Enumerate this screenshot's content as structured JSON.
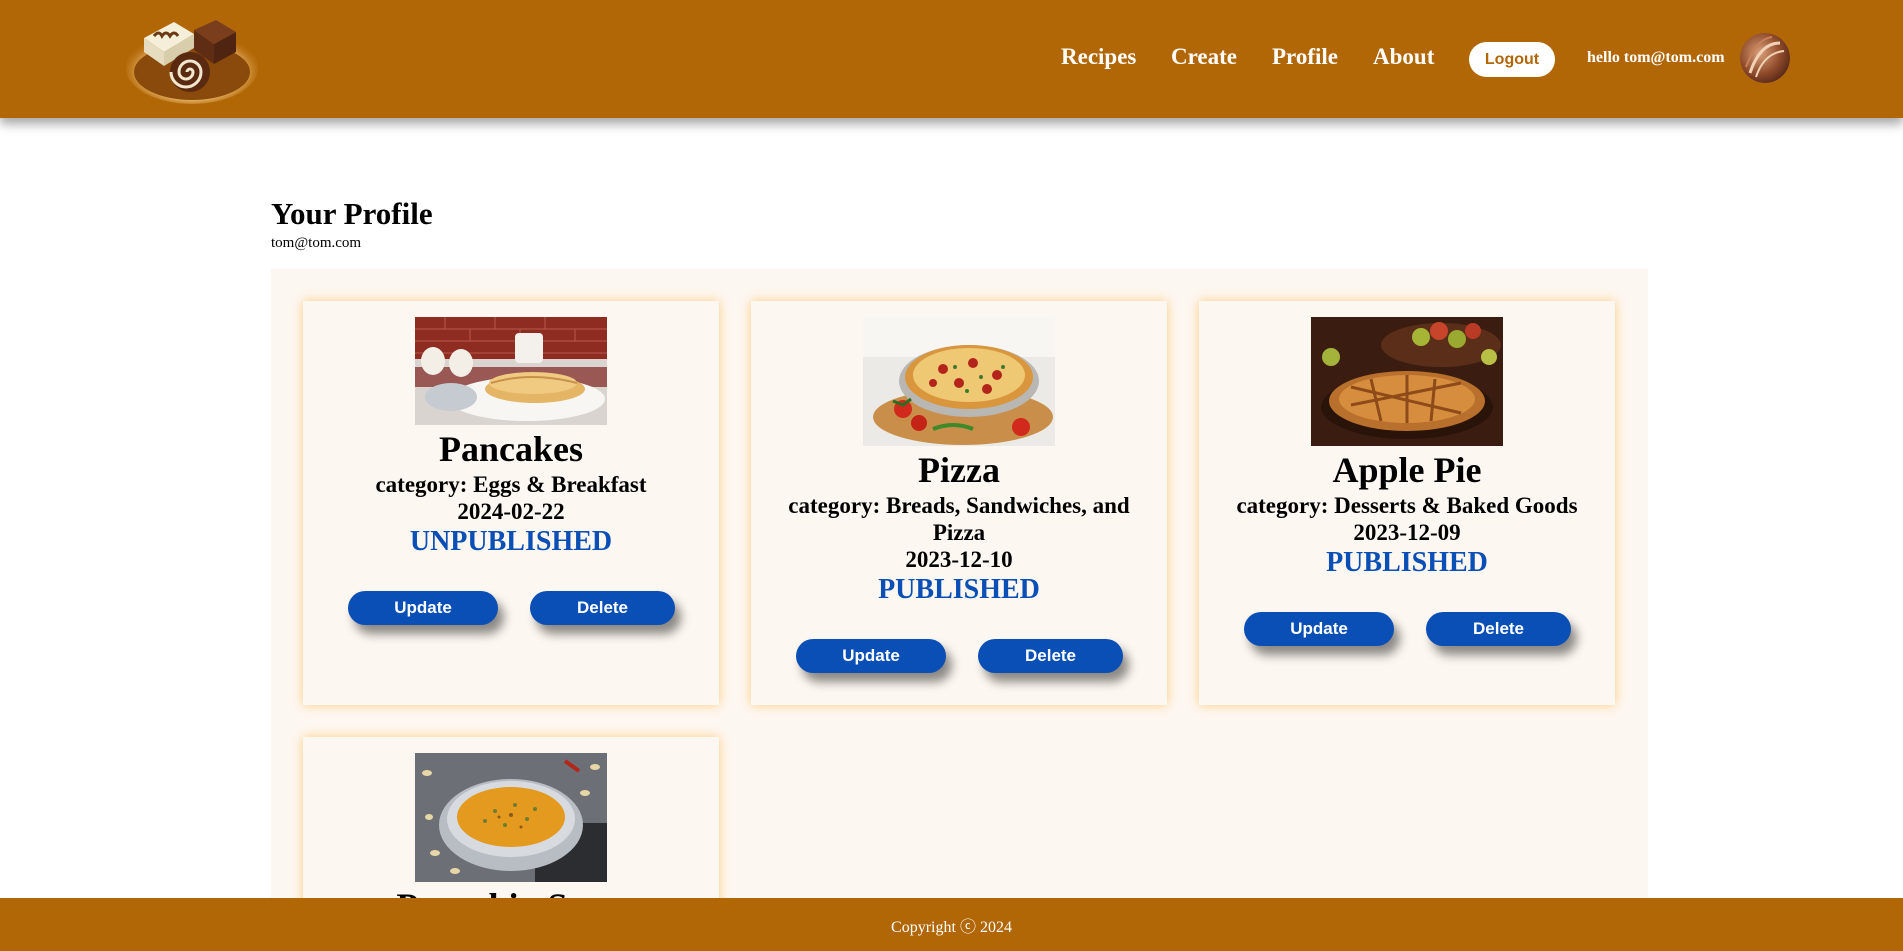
{
  "header": {
    "logo": "chocolate-dessert-logo",
    "nav": [
      {
        "label": "Recipes"
      },
      {
        "label": "Create"
      },
      {
        "label": "Profile"
      },
      {
        "label": "About"
      }
    ],
    "logout_label": "Logout",
    "greeting": "hello tom@tom.com",
    "avatar": "user-avatar-icon"
  },
  "profile": {
    "title": "Your Profile",
    "email": "tom@tom.com"
  },
  "recipes": [
    {
      "title": "Pancakes",
      "category": "category: Eggs & Breakfast",
      "date": "2024-02-22",
      "status": "UNPUBLISHED",
      "image": "pancakes-photo",
      "update_label": "Update",
      "delete_label": "Delete"
    },
    {
      "title": "Pizza",
      "category": "category: Breads, Sandwiches, and Pizza",
      "date": "2023-12-10",
      "status": "PUBLISHED",
      "image": "pizza-photo",
      "update_label": "Update",
      "delete_label": "Delete"
    },
    {
      "title": "Apple Pie",
      "category": "category: Desserts & Baked Goods",
      "date": "2023-12-09",
      "status": "PUBLISHED",
      "image": "apple-pie-photo",
      "update_label": "Update",
      "delete_label": "Delete"
    },
    {
      "title": "Pumpkin Soup",
      "image": "pumpkin-soup-photo"
    }
  ],
  "footer": {
    "copyright": "Copyright ⓒ 2024"
  },
  "colors": {
    "header_bg": "#b26707",
    "accent_blue": "#0a4fb5",
    "card_bg": "#fdf7f1"
  }
}
